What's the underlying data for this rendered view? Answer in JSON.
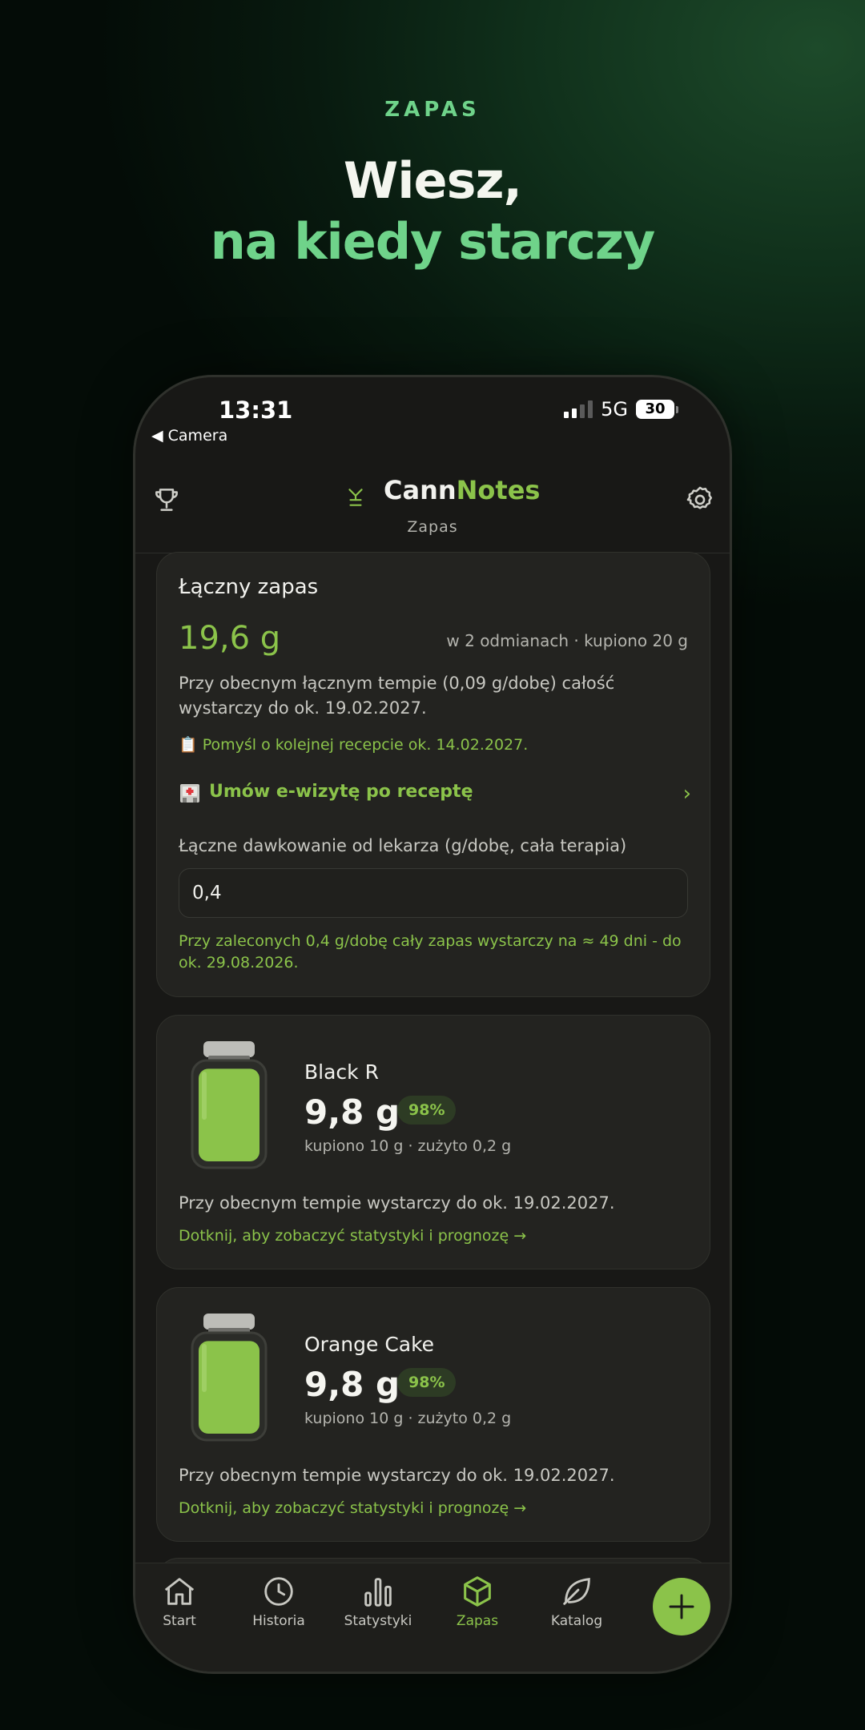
{
  "promo": {
    "eyebrow": "ZAPAS",
    "title_line1": "Wiesz,",
    "title_line2": "na kiedy starczy"
  },
  "status_bar": {
    "time": "13:31",
    "back_label": "◀ Camera",
    "network": "5G",
    "battery": "30"
  },
  "header": {
    "brand_part1": "Cann",
    "brand_part2": "Notes",
    "subtitle": "Zapas",
    "icons": [
      "trophy-icon",
      "cannabis-logo-icon",
      "gear-icon"
    ]
  },
  "summary": {
    "title": "Łączny zapas",
    "amount": "19,6 g",
    "meta": "w 2 odmianach · kupiono 20 g",
    "description": "Przy obecnym łącznym tempie (0,09 g/dobę) całość wystarczy do ok. 19.02.2027.",
    "prescription_hint": "📋 Pomyśl o kolejnej recepcie ok. 14.02.2027.",
    "visit_link": "Umów e-wizytę po receptę",
    "dosage_label": "Łączne dawkowanie od lekarza (g/dobę, cała terapia)",
    "dosage_value": "0,4",
    "recommendation": "Przy zaleconych 0,4 g/dobę cały zapas wystarczy na ≈ 49 dni - do ok. 29.08.2026."
  },
  "strains": [
    {
      "name": "Black R",
      "amount": "9,8 g",
      "badge": "98%",
      "fill_fraction": 0.98,
      "meta": "kupiono 10 g · zużyto 0,2 g",
      "pace": "Przy obecnym tempie wystarczy do ok. 19.02.2027.",
      "link": "Dotknij, aby zobaczyć statystyki i prognozę →"
    },
    {
      "name": "Orange Cake",
      "amount": "9,8 g",
      "badge": "98%",
      "fill_fraction": 0.98,
      "meta": "kupiono 10 g · zużyto 0,2 g",
      "pace": "Przy obecnym tempie wystarczy do ok. 19.02.2027.",
      "link": "Dotknij, aby zobaczyć statystyki i prognozę →"
    }
  ],
  "tabs": [
    {
      "label": "Start",
      "icon": "home-icon",
      "active": false
    },
    {
      "label": "Historia",
      "icon": "clock-icon",
      "active": false
    },
    {
      "label": "Statystyki",
      "icon": "bar-chart-icon",
      "active": false
    },
    {
      "label": "Zapas",
      "icon": "box-icon",
      "active": true
    },
    {
      "label": "Katalog",
      "icon": "leaf-icon",
      "active": false
    }
  ],
  "fab": {
    "icon": "plus-icon"
  },
  "colors": {
    "accent": "#8bc34a",
    "promo_green": "#6fd38a",
    "card_bg": "#232320",
    "phone_bg": "#181816"
  }
}
